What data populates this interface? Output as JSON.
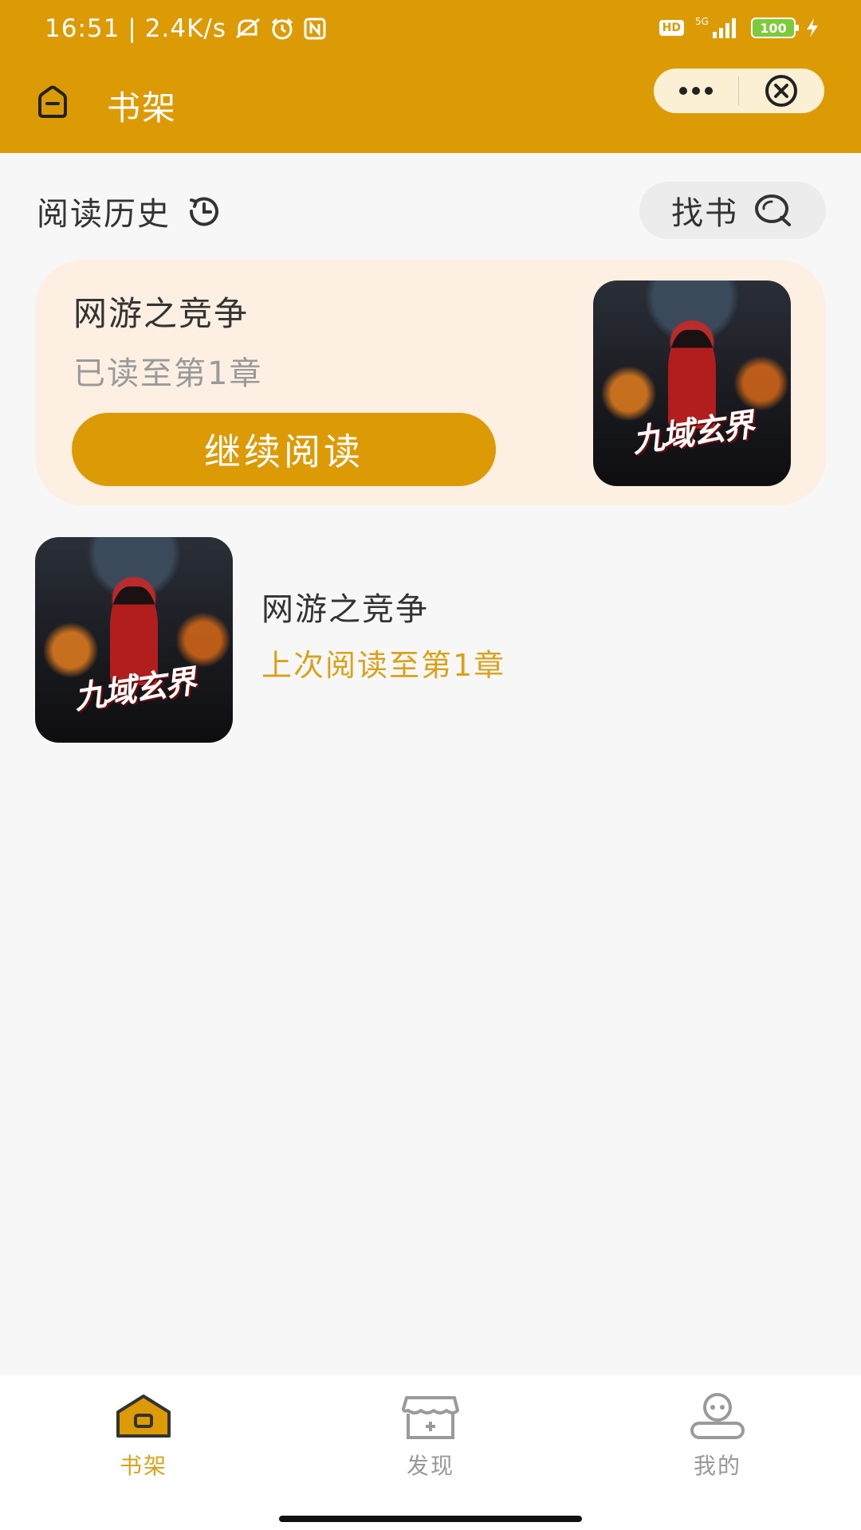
{
  "status_bar": {
    "time": "16:51",
    "speed": "2.4K/s",
    "network": "5G",
    "battery": "100",
    "icons": [
      "mute-icon",
      "alarm-icon",
      "nfc-icon",
      "hd-icon",
      "signal-icon",
      "charging-icon"
    ]
  },
  "nav": {
    "title": "书架",
    "icons": {
      "home": "home-icon",
      "more": "more-icon",
      "close": "close-icon"
    }
  },
  "history": {
    "label": "阅读历史",
    "find_book": "找书",
    "card": {
      "title": "网游之竞争",
      "progress": "已读至第1章",
      "button": "继续阅读",
      "cover_art_text": "九域玄界"
    }
  },
  "book_list": [
    {
      "title": "网游之竞争",
      "last_read": "上次阅读至第1章",
      "cover_art_text": "九域玄界"
    }
  ],
  "tab_bar": {
    "tabs": [
      {
        "label": "书架",
        "icon": "bookshelf-icon",
        "active": true
      },
      {
        "label": "发现",
        "icon": "store-icon",
        "active": false
      },
      {
        "label": "我的",
        "icon": "profile-icon",
        "active": false
      }
    ]
  },
  "colors": {
    "primary": "#DC9A05",
    "accent_text": "#D9A21D",
    "card_bg": "#FDEFE2",
    "page_bg": "#F7F7F7"
  }
}
